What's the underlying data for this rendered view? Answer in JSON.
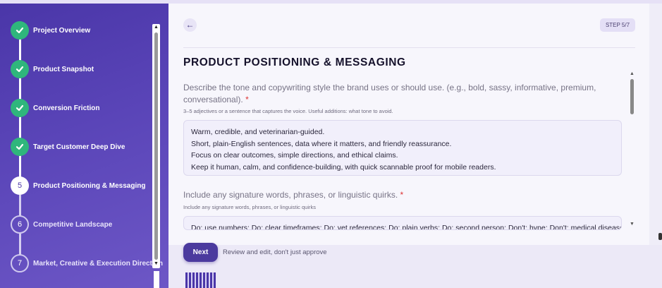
{
  "sidebar": {
    "steps": [
      {
        "number": "1",
        "label": "Project Overview",
        "status": "done"
      },
      {
        "number": "2",
        "label": "Product Snapshot",
        "status": "done"
      },
      {
        "number": "3",
        "label": "Conversion Friction",
        "status": "done"
      },
      {
        "number": "4",
        "label": "Target Customer Deep Dive",
        "status": "done"
      },
      {
        "number": "5",
        "label": "Product Positioning & Messaging",
        "status": "current"
      },
      {
        "number": "6",
        "label": "Competitive Landscape",
        "status": "todo"
      },
      {
        "number": "7",
        "label": "Market, Creative & Execution Direction",
        "status": "todo"
      }
    ],
    "check_icon": "check-icon"
  },
  "header": {
    "back_icon": "←",
    "step_badge": "STEP 5/7"
  },
  "section": {
    "title": "PRODUCT POSITIONING & MESSAGING"
  },
  "questions": [
    {
      "label": "Describe the tone and copywriting style the brand uses or should use. (e.g., bold, sassy, informative, premium, conversational).",
      "required_mark": "*",
      "hint": "3–5 adjectives or a sentence that captures the voice. Useful additions: what tone to avoid.",
      "answer_lines": [
        "Warm, credible, and veterinarian-guided.",
        "Short, plain-English sentences, data where it matters, and friendly reassurance.",
        "Focus on clear outcomes, simple directions, and ethical claims.",
        "Keep it human, calm, and confidence-building, with quick scannable proof for mobile readers."
      ]
    },
    {
      "label": "Include any signature words, phrases, or linguistic quirks.",
      "required_mark": "*",
      "hint": "Include any signature words, phrases, or linguistic quirks",
      "answer_lines": [
        "Do: use numbers; Do: clear timeframes; Do: vet references; Do: plain verbs; Do: second person; Don't: hype; Don't: medical disease"
      ]
    }
  ],
  "footer": {
    "next_label": "Next",
    "review_text": "Review and edit, don't just approve"
  },
  "colors": {
    "sidebar": "#4a36a8",
    "done": "#2fb67c",
    "accent": "#4b3a9e"
  }
}
